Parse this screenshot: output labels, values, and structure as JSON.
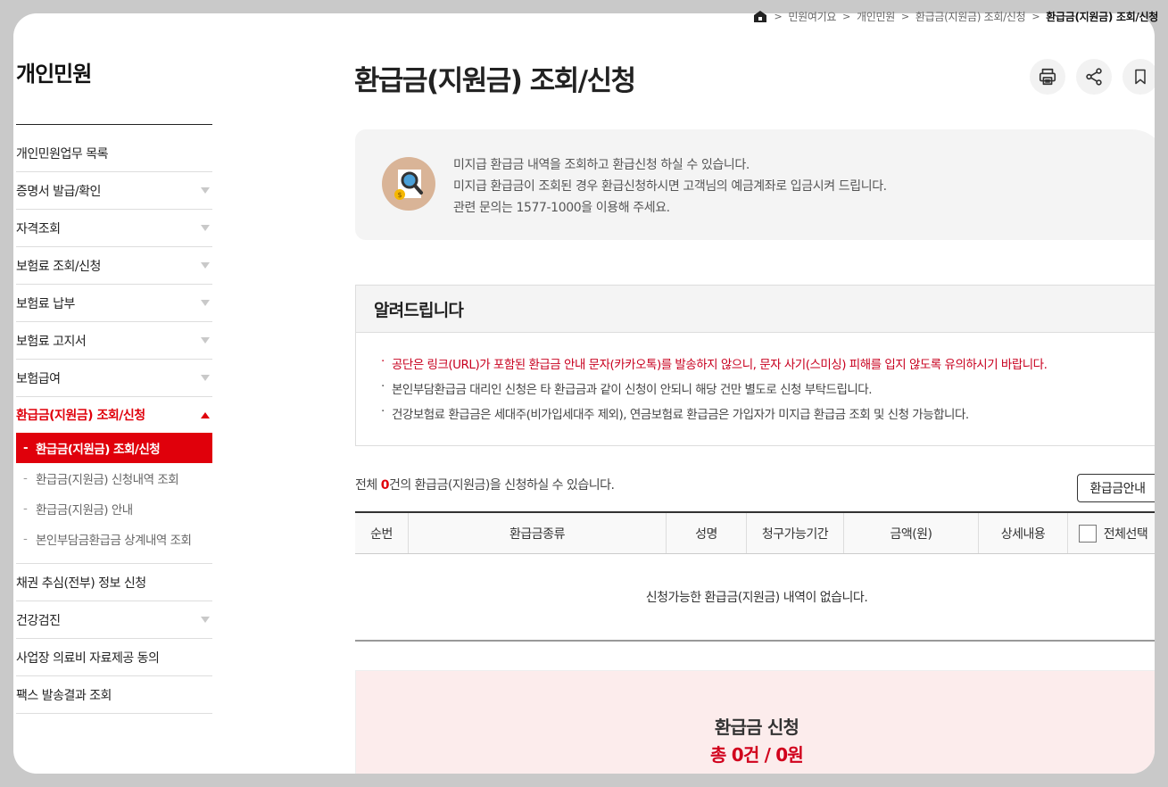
{
  "breadcrumb": {
    "items": [
      "민원여기요",
      "개인민원",
      "환급금(지원금) 조회/신청"
    ],
    "current": "환급금(지원금) 조회/신청"
  },
  "sidebar": {
    "title": "개인민원",
    "items": [
      {
        "label": "개인민원업무 목록"
      },
      {
        "label": "증명서 발급/확인"
      },
      {
        "label": "자격조회"
      },
      {
        "label": "보험료 조회/신청"
      },
      {
        "label": "보험료 납부"
      },
      {
        "label": "보험료 고지서"
      },
      {
        "label": "보험급여"
      },
      {
        "label": "환급금(지원금) 조회/신청"
      },
      {
        "label": "채권 추심(전부) 정보 신청"
      },
      {
        "label": "건강검진"
      },
      {
        "label": "사업장 의료비 자료제공 동의"
      },
      {
        "label": "팩스 발송결과 조회"
      }
    ],
    "subitems": [
      {
        "label": "환급금(지원금) 조회/신청"
      },
      {
        "label": "환급금(지원금) 신청내역 조회"
      },
      {
        "label": "환급금(지원금) 안내"
      },
      {
        "label": "본인부담금환급금 상계내역 조회"
      }
    ]
  },
  "main": {
    "title": "환급금(지원금) 조회/신청",
    "intro": [
      "미지급 환급금 내역을 조회하고 환급신청 하실 수 있습니다.",
      "미지급 환급금이 조회된 경우 환급신청하시면 고객님의 예금계좌로 입금시켜 드립니다.",
      "관련 문의는 1577-1000을 이용해 주세요."
    ],
    "notice": {
      "title": "알려드립니다",
      "lines": [
        "공단은 링크(URL)가 포함된 환급금 안내 문자(카카오톡)를 발송하지 않으니, 문자 사기(스미싱) 피해를 입지 않도록 유의하시기 바랍니다.",
        "본인부담환급금 대리인 신청은 타 환급금과 같이 신청이 안되니 해당 건만 별도로 신청 부탁드립니다.",
        "건강보험료 환급금은 세대주(비가입세대주 제외), 연금보험료 환급금은 가입자가 미지급 환급금 조회 및 신청 가능합니다."
      ]
    },
    "count": {
      "prefix": "전체 ",
      "num": "0",
      "suffix": "건의 환급금(지원금)을 신청하실 수 있습니다."
    },
    "guide_button": "환급금안내",
    "table": {
      "headers": [
        "순번",
        "환급금종류",
        "성명",
        "청구가능기간",
        "금액(원)",
        "상세내용",
        "전체선택"
      ],
      "empty": "신청가능한 환급금(지원금) 내역이 없습니다."
    },
    "apply": {
      "title": "환급금 신청",
      "total": "총 0건 / 0원"
    }
  },
  "colors": {
    "accent": "#e0000b",
    "background": "#c9c9c9"
  },
  "icons": [
    "home-icon",
    "print-icon",
    "share-icon",
    "bookmark-icon",
    "search-document-icon"
  ]
}
